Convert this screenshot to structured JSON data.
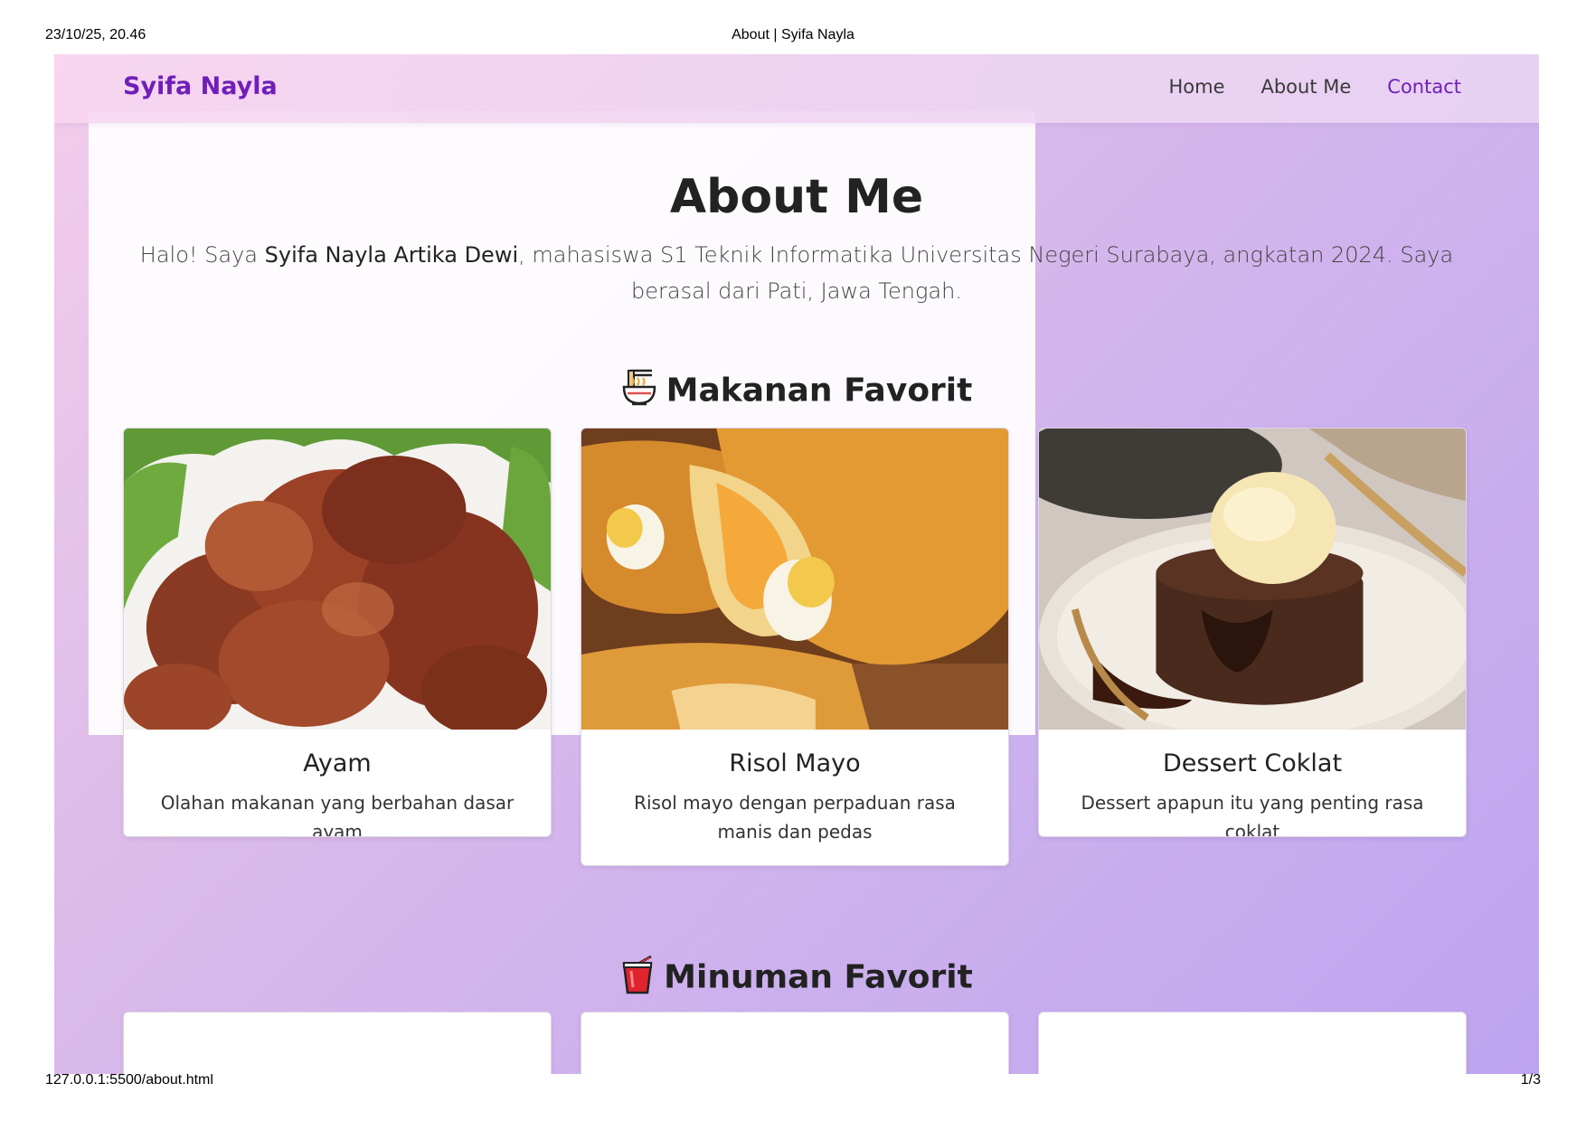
{
  "print": {
    "date": "23/10/25, 20.46",
    "doc_title": "About | Syifa Nayla",
    "url": "127.0.0.1:5500/about.html",
    "page": "1/3"
  },
  "nav": {
    "brand": "Syifa Nayla",
    "links": [
      {
        "label": "Home"
      },
      {
        "label": "About Me"
      },
      {
        "label": "Contact"
      }
    ]
  },
  "about": {
    "title": "About Me",
    "intro_before": "Halo! Saya ",
    "intro_name": "Syifa Nayla Artika Dewi",
    "intro_after": ", mahasiswa S1 Teknik Informatika Universitas Negeri Surabaya, angkatan 2024. Saya berasal dari Pati, Jawa Tengah."
  },
  "food": {
    "title": "Makanan Favorit",
    "icon": "noodle-bowl-icon",
    "items": [
      {
        "name": "Ayam",
        "desc": "Olahan makanan yang berbahan dasar ayam",
        "image": "fried-chicken-photo"
      },
      {
        "name": "Risol Mayo",
        "desc": "Risol mayo dengan perpaduan rasa manis dan pedas",
        "image": "risol-mayo-photo"
      },
      {
        "name": "Dessert Coklat",
        "desc": "Dessert apapun itu yang penting rasa coklat",
        "image": "chocolate-lava-cake-photo"
      }
    ]
  },
  "drink": {
    "title": "Minuman Favorit",
    "icon": "cup-with-straw-icon"
  },
  "colors": {
    "brand": "#6f1fb8",
    "nav_active": "#6f1fb8",
    "text_dark": "#222222"
  }
}
